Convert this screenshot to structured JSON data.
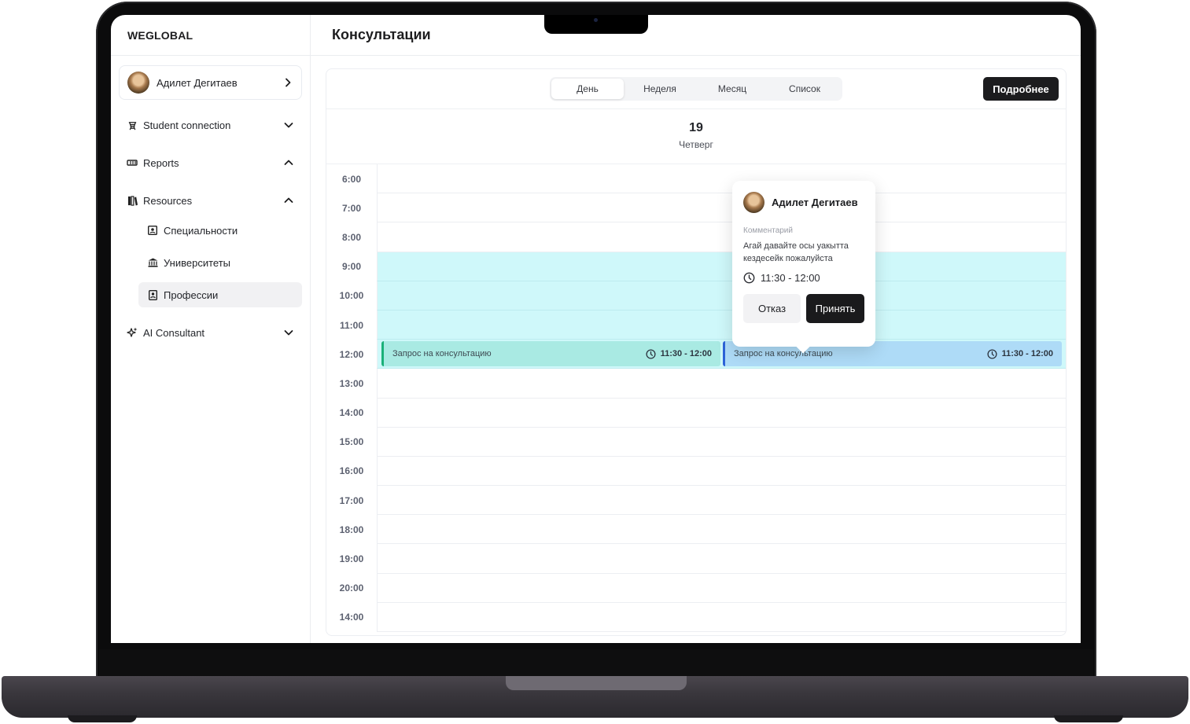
{
  "app": {
    "brand": "WEGLOBAL",
    "page_title": "Консультации"
  },
  "sidebar": {
    "profile": {
      "name": "Адилет Дегитаев",
      "avatar_icon": "user-photo"
    },
    "items": [
      {
        "label": "Student connection",
        "icon": "student-icon",
        "chevron": "down"
      },
      {
        "label": "Reports",
        "icon": "reports-icon",
        "chevron": "up"
      },
      {
        "label": "Resources",
        "icon": "books-icon",
        "chevron": "up"
      },
      {
        "label": "AI Consultant",
        "icon": "sparkle-icon",
        "chevron": "down"
      }
    ],
    "resources_sub": [
      {
        "label": "Специальности",
        "icon": "id-card-icon",
        "active": false
      },
      {
        "label": "Университеты",
        "icon": "university-icon",
        "active": false
      },
      {
        "label": "Профессии",
        "icon": "badge-icon",
        "active": true
      }
    ]
  },
  "calendar": {
    "view_tabs": [
      {
        "label": "День",
        "active": true
      },
      {
        "label": "Неделя",
        "active": false
      },
      {
        "label": "Месяц",
        "active": false
      },
      {
        "label": "Список",
        "active": false
      }
    ],
    "details_button": "Подробнее",
    "day": {
      "number": "19",
      "weekday": "Четверг"
    },
    "time_slots": [
      {
        "time": "6:00",
        "available": false
      },
      {
        "time": "7:00",
        "available": false
      },
      {
        "time": "8:00",
        "available": false
      },
      {
        "time": "9:00",
        "available": true
      },
      {
        "time": "10:00",
        "available": true
      },
      {
        "time": "11:00",
        "available": true
      },
      {
        "time": "12:00",
        "available": true
      },
      {
        "time": "13:00",
        "available": false
      },
      {
        "time": "14:00",
        "available": false
      },
      {
        "time": "15:00",
        "available": false
      },
      {
        "time": "16:00",
        "available": false
      },
      {
        "time": "17:00",
        "available": false
      },
      {
        "time": "18:00",
        "available": false
      },
      {
        "time": "19:00",
        "available": false
      },
      {
        "time": "20:00",
        "available": false
      },
      {
        "time": "14:00",
        "available": false
      }
    ],
    "events": [
      {
        "title": "Запрос на консультацию",
        "time": "11:30 - 12:00",
        "color": "#a9eae3",
        "accent": "#1ab079"
      },
      {
        "title": "Запрос на консультацию",
        "time": "11:30 - 12:00",
        "color": "#aedbf7",
        "accent": "#2d63d8"
      }
    ],
    "available_color": "#cff8fa"
  },
  "popover": {
    "name": "Адилет Дегитаев",
    "comment_label": "Комментарий",
    "comment": "Агай давайте осы уакытта кездесейк пожалуйста",
    "time": "11:30 - 12:00",
    "decline_label": "Отказ",
    "accept_label": "Принять"
  }
}
